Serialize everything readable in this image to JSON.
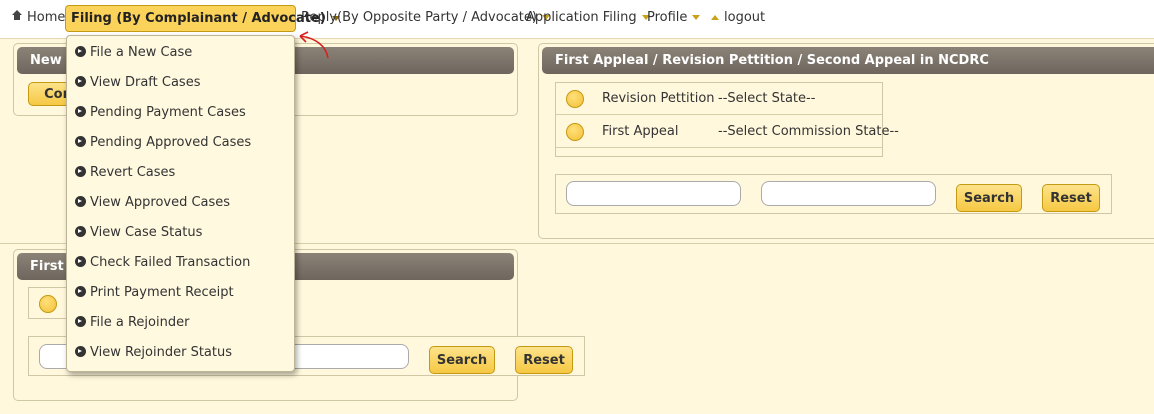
{
  "nav": {
    "home": "Home",
    "filing": "Filing (By Complainant / Advocate)",
    "reply": "Reply(By Opposite Party / Advocate)",
    "application": "Application Filing",
    "profile": "Profile",
    "logout": "logout"
  },
  "left_top_panel": {
    "title": "New C",
    "button": "Con"
  },
  "right_panel": {
    "title": "First Appleal / Revision Pettition / Second Appeal in NCDRC",
    "rows": [
      {
        "label": "Revision Pettition",
        "select": "--Select State--"
      },
      {
        "label": "First Appeal",
        "select": "--Select Commission State--"
      }
    ],
    "search_label": "Search",
    "reset_label": "Reset"
  },
  "left_bottom_panel": {
    "title": "First A",
    "search_label": "Search",
    "reset_label": "Reset"
  },
  "dropdown": {
    "items": [
      "File a New Case",
      "View Draft Cases",
      "Pending Payment Cases",
      "Pending Approved Cases",
      "Revert Cases",
      "View Approved Cases",
      "View Case Status",
      "Check Failed Transaction",
      "Print Payment Receipt",
      "File a Rejoinder",
      "View Rejoinder Status"
    ]
  },
  "colors": {
    "accent": "#fcd35a",
    "page_bg": "#fff8dc",
    "header_bg": "#7d756c",
    "annotation_arrow": "#d92020"
  }
}
